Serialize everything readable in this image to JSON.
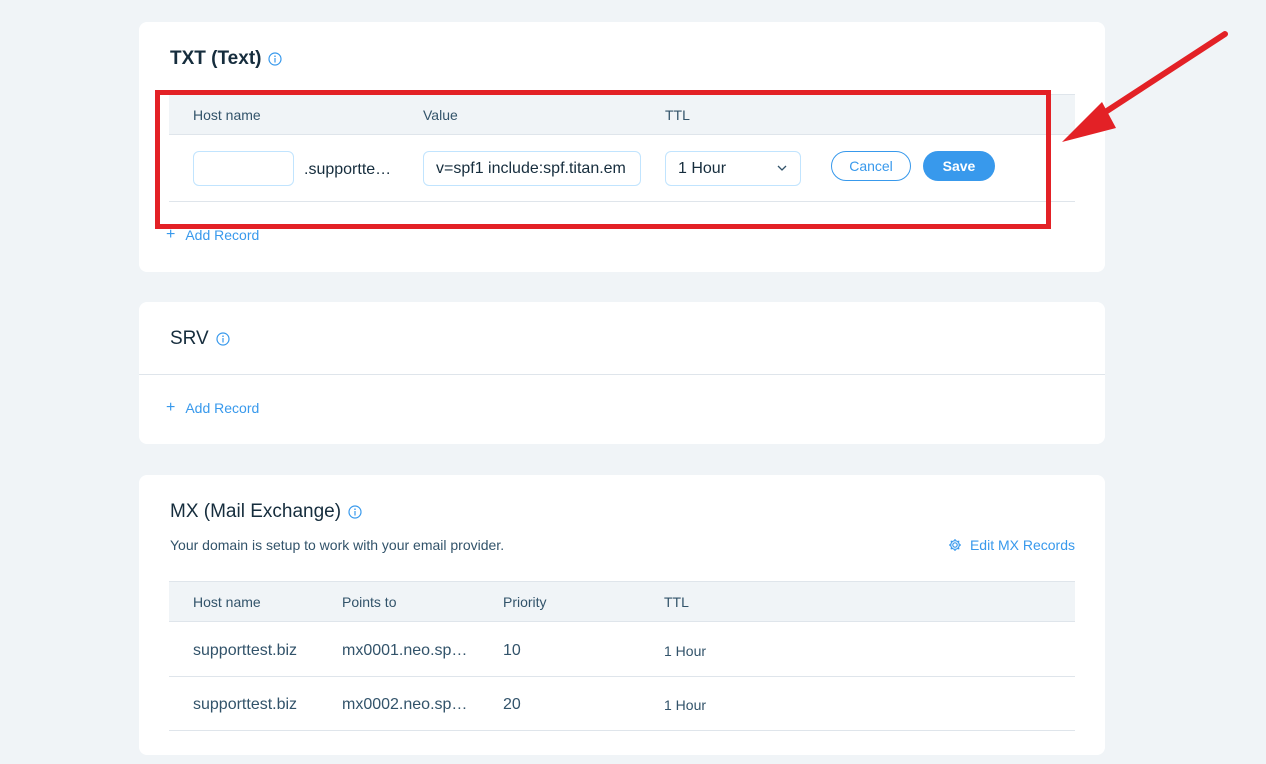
{
  "txt_section": {
    "title": "TXT (Text)",
    "columns": {
      "host": "Host name",
      "value": "Value",
      "ttl": "TTL"
    },
    "edit_row": {
      "host_value": "",
      "host_suffix": ".supportte…",
      "value_text": "v=spf1 include:spf.titan.em",
      "ttl_selected": "1 Hour",
      "cancel_label": "Cancel",
      "save_label": "Save"
    },
    "add_record_label": "Add Record"
  },
  "srv_section": {
    "title": "SRV",
    "add_record_label": "Add Record"
  },
  "mx_section": {
    "title": "MX (Mail Exchange)",
    "description": "Your domain is setup to work with your email provider.",
    "edit_label": "Edit MX Records",
    "columns": {
      "host": "Host name",
      "points_to": "Points to",
      "priority": "Priority",
      "ttl": "TTL"
    },
    "rows": [
      {
        "host": "supporttest.biz",
        "points_to": "mx0001.neo.sp…",
        "priority": "10",
        "ttl": "1 Hour"
      },
      {
        "host": "supporttest.biz",
        "points_to": "mx0002.neo.sp…",
        "priority": "20",
        "ttl": "1 Hour"
      }
    ]
  },
  "colors": {
    "accent": "#3899ec",
    "annotation": "#e32126",
    "background": "#f0f4f7"
  }
}
